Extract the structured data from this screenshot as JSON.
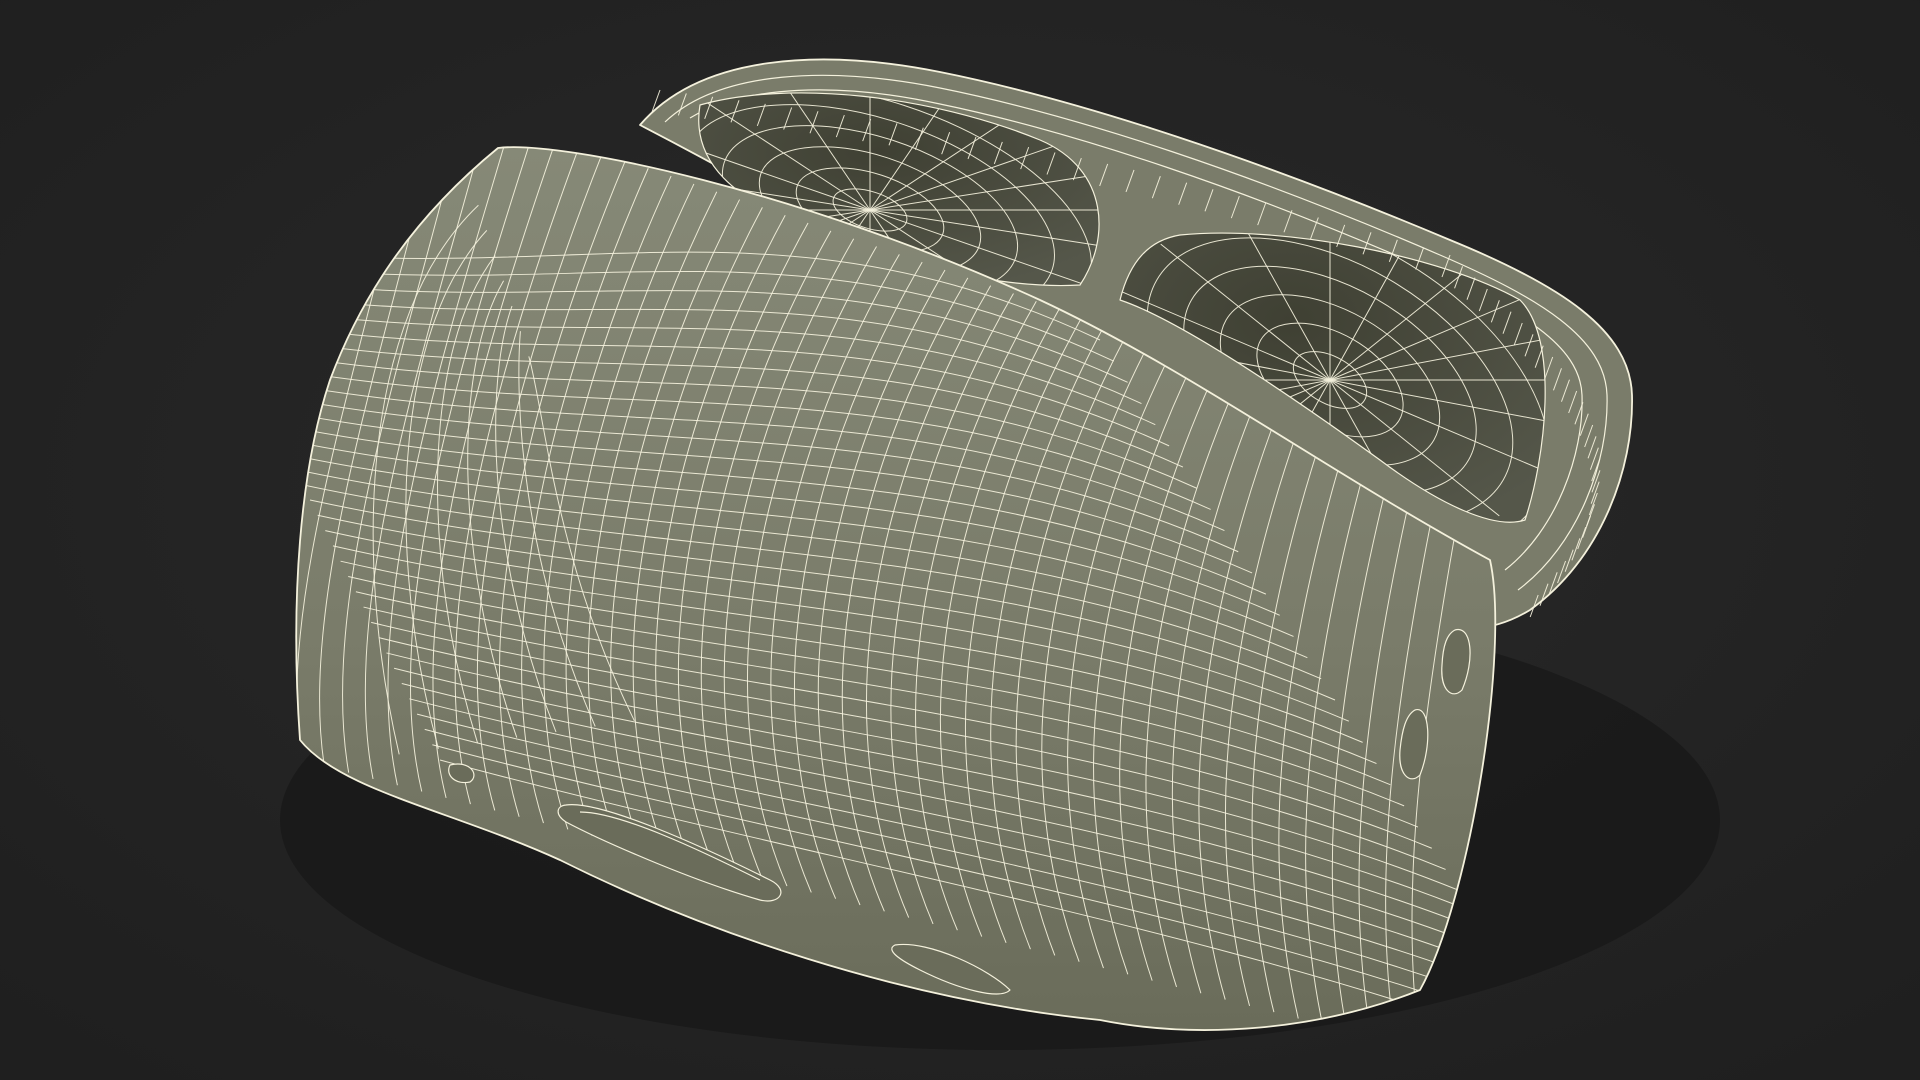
{
  "scene": {
    "subject": "wireframe-earbuds-charging-case",
    "colors": {
      "background_center": "#2a2a2a",
      "background_edge": "#1f1f1f",
      "surface": "#7a7c6a",
      "surface_light": "#868977",
      "surface_dark": "#6a6c5a",
      "cavity_dark": "#3f4033",
      "cavity_mid": "#55574a",
      "wire": "#f4f1dc",
      "shadow": "#141414"
    }
  }
}
